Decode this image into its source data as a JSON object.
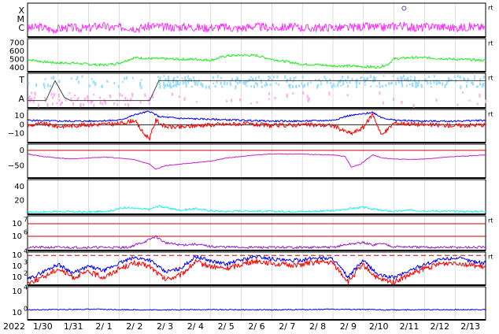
{
  "chart_data": {
    "type": "line",
    "year_label": "2022",
    "x_ticks": [
      "1/30",
      "1/31",
      "2/ 1",
      "2/ 2",
      "2/ 3",
      "2/ 4",
      "2/ 5",
      "2/ 6",
      "2/ 7",
      "2/ 8",
      "2/ 9",
      "2/10",
      "2/11",
      "2/12",
      "2/13"
    ],
    "panels": [
      {
        "id": "xray",
        "y_tick_labels": [
          "X",
          "M",
          "C"
        ],
        "right_tag": "rt",
        "color": "#ff22ff",
        "points": [
          [
            0,
            0.25
          ],
          [
            0.4,
            0.3
          ],
          [
            0.8,
            0.22
          ],
          [
            1.3,
            0.28
          ],
          [
            1.9,
            0.25
          ],
          [
            2.4,
            0.35
          ],
          [
            2.7,
            0.27
          ],
          [
            3.2,
            0.3
          ],
          [
            3.6,
            0.26
          ],
          [
            4.1,
            0.33
          ],
          [
            4.6,
            0.28
          ],
          [
            5.2,
            0.31
          ],
          [
            5.8,
            0.27
          ],
          [
            6.3,
            0.3
          ],
          [
            6.9,
            0.25
          ],
          [
            7.4,
            0.32
          ],
          [
            8.0,
            0.27
          ],
          [
            8.6,
            0.3
          ],
          [
            9.2,
            0.26
          ],
          [
            9.8,
            0.29
          ],
          [
            10.4,
            0.27
          ],
          [
            11.0,
            0.31
          ],
          [
            11.6,
            0.28
          ],
          [
            12.2,
            0.35
          ],
          [
            12.7,
            0.26
          ],
          [
            13.3,
            0.33
          ],
          [
            13.9,
            0.27
          ],
          [
            14.5,
            0.3
          ],
          [
            15.0,
            0.28
          ]
        ],
        "events": [
          [
            12.33,
            0.85
          ]
        ]
      },
      {
        "id": "solar_wind_speed",
        "y_tick_labels": [
          "700",
          "600",
          "500",
          "400"
        ],
        "y_ticks": [
          700,
          600,
          500,
          400
        ],
        "ylim": [
          350,
          750
        ],
        "right_tag": "rt",
        "color": "#22ee22",
        "points": [
          [
            0,
            500
          ],
          [
            0.5,
            470
          ],
          [
            1.0,
            455
          ],
          [
            1.5,
            455
          ],
          [
            2.0,
            440
          ],
          [
            2.5,
            430
          ],
          [
            3.0,
            455
          ],
          [
            3.5,
            520
          ],
          [
            4.0,
            510
          ],
          [
            4.5,
            505
          ],
          [
            5.0,
            500
          ],
          [
            5.5,
            500
          ],
          [
            6.0,
            490
          ],
          [
            6.5,
            540
          ],
          [
            7.0,
            550
          ],
          [
            7.5,
            545
          ],
          [
            8.0,
            500
          ],
          [
            8.5,
            470
          ],
          [
            9.0,
            440
          ],
          [
            9.5,
            435
          ],
          [
            10.0,
            420
          ],
          [
            10.5,
            420
          ],
          [
            11.0,
            410
          ],
          [
            11.5,
            405
          ],
          [
            11.8,
            440
          ],
          [
            12.0,
            505
          ],
          [
            12.5,
            520
          ],
          [
            13.0,
            520
          ],
          [
            13.5,
            510
          ],
          [
            14.0,
            500
          ],
          [
            14.5,
            495
          ],
          [
            15.0,
            485
          ]
        ]
      },
      {
        "id": "imf_direction",
        "y_tick_labels": [
          "T",
          "A"
        ],
        "right_tag": "rt",
        "color_t": "#99ddff",
        "color_a": "#ffaaee",
        "line_color": "#444444",
        "line_points": [
          [
            0.0,
            0.05
          ],
          [
            0.6,
            0.05
          ],
          [
            0.9,
            0.95
          ],
          [
            1.2,
            0.2
          ],
          [
            1.4,
            0.05
          ],
          [
            4.0,
            0.05
          ],
          [
            4.3,
            0.95
          ],
          [
            15.0,
            0.95
          ]
        ]
      },
      {
        "id": "imf_bz",
        "y_tick_labels": [
          "10",
          "0",
          "−10"
        ],
        "y_ticks": [
          10,
          0,
          -10
        ],
        "ylim": [
          -20,
          17
        ],
        "right_tag": "rt",
        "total_color": "#0000ff",
        "bz_color": "#ff0000",
        "bt_points": [
          [
            0,
            5
          ],
          [
            1,
            4
          ],
          [
            2,
            4
          ],
          [
            3,
            5
          ],
          [
            3.6,
            12
          ],
          [
            4.0,
            15
          ],
          [
            4.3,
            9
          ],
          [
            5,
            7
          ],
          [
            6,
            6
          ],
          [
            7,
            5
          ],
          [
            8,
            4
          ],
          [
            9,
            4
          ],
          [
            10,
            5
          ],
          [
            10.5,
            10
          ],
          [
            11,
            12
          ],
          [
            11.3,
            14
          ],
          [
            11.6,
            8
          ],
          [
            12,
            5
          ],
          [
            13,
            4
          ],
          [
            14,
            4
          ],
          [
            15,
            5
          ]
        ],
        "bz_points": [
          [
            0,
            -1
          ],
          [
            0.5,
            1
          ],
          [
            1,
            -2
          ],
          [
            2,
            0
          ],
          [
            3,
            1
          ],
          [
            3.5,
            5
          ],
          [
            3.8,
            -10
          ],
          [
            4.0,
            -15
          ],
          [
            4.2,
            5
          ],
          [
            4.5,
            -2
          ],
          [
            5,
            -3
          ],
          [
            5.5,
            -1
          ],
          [
            6,
            0
          ],
          [
            7,
            1
          ],
          [
            8,
            -1
          ],
          [
            9,
            0
          ],
          [
            10,
            -1
          ],
          [
            10.3,
            -6
          ],
          [
            10.6,
            -10
          ],
          [
            11,
            -3
          ],
          [
            11.3,
            12
          ],
          [
            11.6,
            -12
          ],
          [
            12,
            2
          ],
          [
            13,
            0
          ],
          [
            14,
            -1
          ],
          [
            15,
            0
          ]
        ]
      },
      {
        "id": "dst",
        "y_tick_labels": [
          "0",
          "−50"
        ],
        "y_ticks": [
          0,
          -50
        ],
        "ylim": [
          -90,
          20
        ],
        "right_tag": "",
        "color": "#cc22cc",
        "ref_color": "#cc0000",
        "points": [
          [
            0,
            -12
          ],
          [
            0.5,
            -20
          ],
          [
            1,
            -25
          ],
          [
            1.5,
            -28
          ],
          [
            2,
            -25
          ],
          [
            2.5,
            -22
          ],
          [
            3,
            -25
          ],
          [
            3.5,
            -30
          ],
          [
            4.0,
            -45
          ],
          [
            4.2,
            -62
          ],
          [
            4.5,
            -50
          ],
          [
            5,
            -45
          ],
          [
            5.5,
            -40
          ],
          [
            6,
            -35
          ],
          [
            6.5,
            -25
          ],
          [
            7,
            -20
          ],
          [
            7.5,
            -15
          ],
          [
            8,
            -12
          ],
          [
            8.5,
            -12
          ],
          [
            9,
            -12
          ],
          [
            9.5,
            -14
          ],
          [
            10,
            -15
          ],
          [
            10.4,
            -20
          ],
          [
            10.6,
            -55
          ],
          [
            10.9,
            -45
          ],
          [
            11.3,
            -15
          ],
          [
            11.6,
            -25
          ],
          [
            12,
            -28
          ],
          [
            12.5,
            -30
          ],
          [
            13,
            -28
          ],
          [
            13.5,
            -24
          ],
          [
            14,
            -20
          ],
          [
            14.5,
            -18
          ],
          [
            15,
            -15
          ]
        ]
      },
      {
        "id": "proton_density",
        "y_tick_labels": [
          "40",
          "20"
        ],
        "y_ticks": [
          40,
          20
        ],
        "ylim": [
          0,
          50
        ],
        "right_tag": "",
        "color": "#22eeee",
        "points": [
          [
            0,
            3
          ],
          [
            1,
            4
          ],
          [
            2,
            3
          ],
          [
            2.7,
            5
          ],
          [
            3.2,
            10
          ],
          [
            3.6,
            8
          ],
          [
            4.0,
            7
          ],
          [
            4.3,
            12
          ],
          [
            4.6,
            9
          ],
          [
            5,
            6
          ],
          [
            5.5,
            8
          ],
          [
            6,
            5
          ],
          [
            6.5,
            4
          ],
          [
            7,
            5
          ],
          [
            8,
            4
          ],
          [
            9,
            4
          ],
          [
            10,
            5
          ],
          [
            10.5,
            8
          ],
          [
            11,
            10
          ],
          [
            11.5,
            6
          ],
          [
            12,
            4
          ],
          [
            12.5,
            6
          ],
          [
            13,
            5
          ],
          [
            14,
            4
          ],
          [
            15,
            4
          ]
        ]
      },
      {
        "id": "proton_flux",
        "y_tick_labels": [
          "10",
          "10"
        ],
        "y_tick_exponents": [
          "7",
          "6"
        ],
        "right_tag": "rt",
        "color": "#9922cc",
        "ref_color": "#cc0000",
        "points": [
          [
            0,
            0.1
          ],
          [
            3.3,
            0.1
          ],
          [
            3.6,
            0.3
          ],
          [
            3.9,
            0.5
          ],
          [
            4.2,
            0.8
          ],
          [
            4.5,
            0.4
          ],
          [
            5,
            0.25
          ],
          [
            5.5,
            0.3
          ],
          [
            6,
            0.15
          ],
          [
            7,
            0.1
          ],
          [
            8,
            0.1
          ],
          [
            9,
            0.1
          ],
          [
            10,
            0.1
          ],
          [
            10.5,
            0.3
          ],
          [
            11,
            0.4
          ],
          [
            11.3,
            0.25
          ],
          [
            11.6,
            0.35
          ],
          [
            12,
            0.15
          ],
          [
            13,
            0.1
          ],
          [
            15,
            0.1
          ]
        ]
      },
      {
        "id": "electron_flux",
        "y_tick_labels": [
          "10",
          "10",
          "10"
        ],
        "y_tick_exponents": [
          "4",
          "3",
          "2"
        ],
        "right_tag": "rt",
        "ge2_color": "#0000ff",
        "ge08_color": "#ff0000",
        "threshold_color": "#cc0000",
        "ge2_points": [
          [
            0,
            1.8
          ],
          [
            0.5,
            2.5
          ],
          [
            1,
            3.2
          ],
          [
            1.5,
            2.4
          ],
          [
            2,
            3.0
          ],
          [
            2.5,
            2.6
          ],
          [
            3,
            3.3
          ],
          [
            3.5,
            3.8
          ],
          [
            4,
            3.6
          ],
          [
            4.5,
            2.5
          ],
          [
            5,
            2.8
          ],
          [
            5.5,
            3.9
          ],
          [
            6,
            3.5
          ],
          [
            6.5,
            3.2
          ],
          [
            7,
            3.6
          ],
          [
            7.5,
            3.9
          ],
          [
            8,
            3.7
          ],
          [
            8.5,
            3.5
          ],
          [
            9,
            3.6
          ],
          [
            9.5,
            3.8
          ],
          [
            10,
            3.7
          ],
          [
            10.5,
            2.0
          ],
          [
            10.8,
            3.0
          ],
          [
            11,
            3.5
          ],
          [
            11.5,
            2.2
          ],
          [
            12,
            2.0
          ],
          [
            12.5,
            2.6
          ],
          [
            13,
            3.2
          ],
          [
            13.5,
            3.6
          ],
          [
            14,
            3.8
          ],
          [
            14.5,
            3.5
          ],
          [
            15,
            3.3
          ]
        ],
        "ge08_points": [
          [
            0,
            1.5
          ],
          [
            0.5,
            2.0
          ],
          [
            1,
            2.8
          ],
          [
            1.5,
            2.0
          ],
          [
            2,
            2.5
          ],
          [
            2.5,
            2.0
          ],
          [
            3,
            2.8
          ],
          [
            3.5,
            3.3
          ],
          [
            4,
            3.0
          ],
          [
            4.5,
            1.8
          ],
          [
            5,
            2.2
          ],
          [
            5.5,
            3.4
          ],
          [
            6,
            3.0
          ],
          [
            6.5,
            2.8
          ],
          [
            7,
            3.2
          ],
          [
            7.5,
            3.5
          ],
          [
            8,
            3.3
          ],
          [
            8.5,
            3.1
          ],
          [
            9,
            3.2
          ],
          [
            9.5,
            3.4
          ],
          [
            10,
            3.3
          ],
          [
            10.5,
            1.6
          ],
          [
            10.8,
            2.6
          ],
          [
            11,
            3.1
          ],
          [
            11.5,
            1.8
          ],
          [
            12,
            1.6
          ],
          [
            12.5,
            2.2
          ],
          [
            13,
            2.8
          ],
          [
            13.5,
            3.2
          ],
          [
            14,
            3.4
          ],
          [
            14.5,
            3.1
          ],
          [
            15,
            2.9
          ]
        ]
      },
      {
        "id": "electron_flux_2",
        "y_tick_labels": [
          "10",
          "10"
        ],
        "y_tick_exponents": [
          "4",
          "0"
        ],
        "right_tag": "",
        "color": "#0000ff",
        "points": [
          [
            0,
            0.3
          ],
          [
            2,
            0.32
          ],
          [
            4,
            0.3
          ],
          [
            6,
            0.31
          ],
          [
            8,
            0.3
          ],
          [
            10,
            0.32
          ],
          [
            12,
            0.3
          ],
          [
            15,
            0.31
          ]
        ]
      }
    ]
  }
}
